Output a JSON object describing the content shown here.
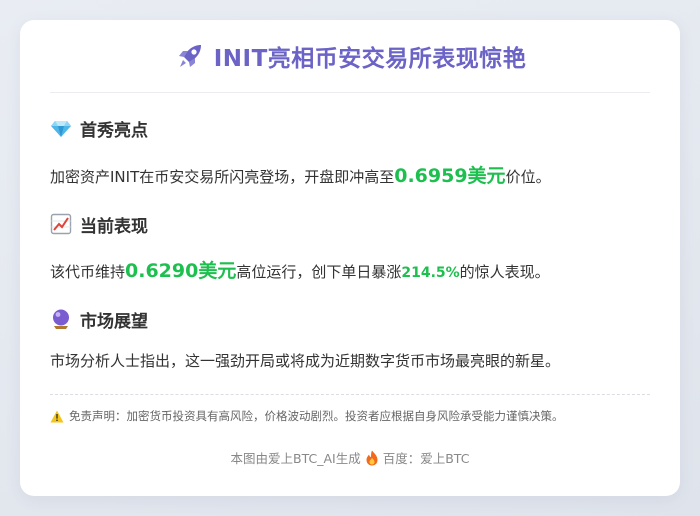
{
  "title": "INIT亮相币安交易所表现惊艳",
  "sections": [
    {
      "heading": "首秀亮点",
      "icon": "diamond-icon",
      "text_before": "加密资产INIT在币安交易所闪亮登场，开盘即冲高至",
      "highlight": "0.6959美元",
      "text_after": "价位。"
    },
    {
      "heading": "当前表现",
      "icon": "chart-up-icon",
      "text_before": "该代币维持",
      "highlight": "0.6290美元",
      "text_mid": "高位运行，创下单日暴涨",
      "highlight2": "214.5%",
      "text_after": "的惊人表现。"
    },
    {
      "heading": "市场展望",
      "icon": "crystal-ball-icon",
      "text": "市场分析人士指出，这一强劲开局或将成为近期数字货币市场最亮眼的新星。"
    }
  ],
  "disclaimer": "免责声明：加密货币投资具有高风险，价格波动剧烈。投资者应根据自身风险承受能力谨慎决策。",
  "footer": {
    "left": "本图由爱上BTC_AI生成",
    "right": "百度：爱上BTC"
  },
  "colors": {
    "title": "#6b63c6",
    "highlight": "#1dbf4e",
    "background": "#e3e7ee"
  }
}
